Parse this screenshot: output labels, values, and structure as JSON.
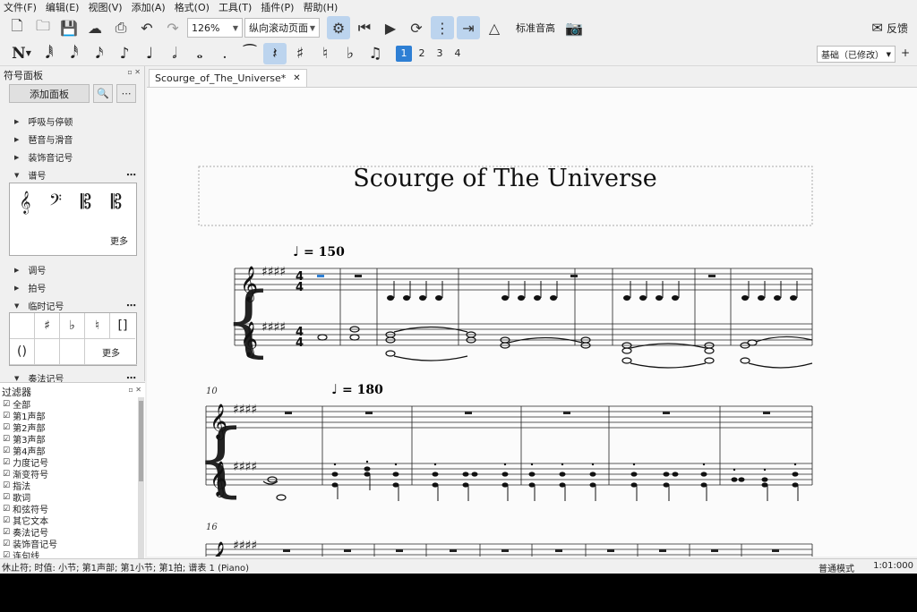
{
  "menubar": {
    "items": [
      "文件(F)",
      "编辑(E)",
      "视图(V)",
      "添加(A)",
      "格式(O)",
      "工具(T)",
      "插件(P)",
      "帮助(H)"
    ]
  },
  "toolbar": {
    "zoom_value": "126%",
    "view_mode": "纵向滚动页面",
    "concert_pitch_label": "标准音高",
    "feedback_label": "反馈"
  },
  "note_toolbar": {
    "voices": [
      "1",
      "2",
      "3",
      "4"
    ],
    "workspace": "基础（已修改）"
  },
  "palette": {
    "title": "符号面板",
    "add_button": "添加面板",
    "sections": [
      {
        "label": "呼吸与停顿",
        "expanded": false
      },
      {
        "label": "琶音与滑音",
        "expanded": false
      },
      {
        "label": "装饰音记号",
        "expanded": false
      },
      {
        "label": "谱号",
        "expanded": true
      },
      {
        "label": "调号",
        "expanded": false
      },
      {
        "label": "拍号",
        "expanded": false
      },
      {
        "label": "临时记号",
        "expanded": true
      },
      {
        "label": "奏法记号",
        "expanded": true
      }
    ],
    "clefs": [
      "𝄞",
      "𝄢",
      "𝄡",
      "𝄡"
    ],
    "more_label": "更多",
    "accidentals": [
      "",
      "♯",
      "♭",
      "♮",
      "[]",
      "()",
      "",
      "",
      "更多"
    ]
  },
  "filter": {
    "title": "过滤器",
    "items": [
      "全部",
      "第1声部",
      "第2声部",
      "第3声部",
      "第4声部",
      "力度记号",
      "渐变符号",
      "指法",
      "歌词",
      "和弦符号",
      "其它文本",
      "奏法记号",
      "装饰音记号",
      "连句线"
    ]
  },
  "score": {
    "tab_title": "Scourge_of_The_Universe*",
    "title": "Scourge of The Universe",
    "tempo1": "= 150",
    "tempo2": "= 180",
    "system2_measure": "10",
    "system3_measure": "16"
  },
  "status": {
    "text": "休止符; 时值: 小节; 第1声部;  第1小节; 第1拍; 谱表 1 (Piano)",
    "mode": "普通模式",
    "time": "1:01:000"
  },
  "colors": {
    "active_blue": "#2e7fd4",
    "selection": "#bcd4ee"
  }
}
